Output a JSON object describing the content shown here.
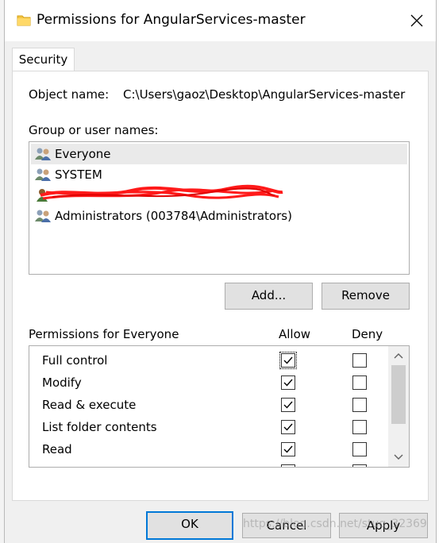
{
  "window": {
    "title": "Permissions for AngularServices-master",
    "close_icon": "close-icon",
    "folder_icon": "folder-icon"
  },
  "tabs": [
    {
      "label": "Security",
      "active": true
    }
  ],
  "object": {
    "label": "Object name:",
    "value": "C:\\Users\\gaoz\\Desktop\\AngularServices-master"
  },
  "groups": {
    "label": "Group or user names:",
    "items": [
      {
        "name": "Everyone",
        "icon": "users-group-icon",
        "selected": true
      },
      {
        "name": "SYSTEM",
        "icon": "users-group-icon",
        "selected": false
      },
      {
        "name": "",
        "icon": "user-icon",
        "selected": false,
        "redacted": true
      },
      {
        "name": "Administrators (003784\\Administrators)",
        "icon": "users-group-icon",
        "selected": false
      }
    ]
  },
  "buttons": {
    "add": "Add...",
    "remove": "Remove",
    "ok": "OK",
    "cancel": "Cancel",
    "apply": "Apply"
  },
  "permissions": {
    "header": "Permissions for Everyone",
    "allow_label": "Allow",
    "deny_label": "Deny",
    "rows": [
      {
        "name": "Full control",
        "allow": true,
        "deny": false
      },
      {
        "name": "Modify",
        "allow": true,
        "deny": false
      },
      {
        "name": "Read & execute",
        "allow": true,
        "deny": false
      },
      {
        "name": "List folder contents",
        "allow": true,
        "deny": false
      },
      {
        "name": "Read",
        "allow": true,
        "deny": false
      }
    ]
  },
  "watermark": "https://blog.csdn.net/stuq_32369",
  "colors": {
    "accent": "#0078d7",
    "scribble": "#ff1a1a"
  }
}
